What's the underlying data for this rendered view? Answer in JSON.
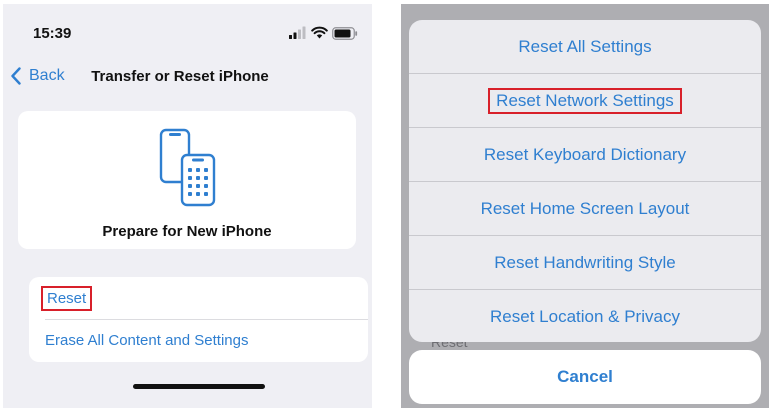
{
  "left_screen": {
    "status_bar": {
      "time": "15:39",
      "icons": [
        "cellular-signal-icon",
        "wifi-icon",
        "battery-icon"
      ]
    },
    "nav": {
      "back_label": "Back",
      "title": "Transfer or Reset iPhone"
    },
    "prepare_card": {
      "icon": "phones-transfer-icon",
      "label": "Prepare for New iPhone"
    },
    "reset_list": {
      "items": [
        {
          "label": "Reset",
          "highlighted": true
        },
        {
          "label": "Erase All Content and Settings",
          "highlighted": false
        }
      ]
    }
  },
  "right_screen": {
    "background_label": "Reset",
    "action_sheet": {
      "items": [
        {
          "label": "Reset All Settings",
          "highlighted": false
        },
        {
          "label": "Reset Network Settings",
          "highlighted": true
        },
        {
          "label": "Reset Keyboard Dictionary",
          "highlighted": false
        },
        {
          "label": "Reset Home Screen Layout",
          "highlighted": false
        },
        {
          "label": "Reset Handwriting Style",
          "highlighted": false
        },
        {
          "label": "Reset Location & Privacy",
          "highlighted": false
        }
      ],
      "cancel_label": "Cancel"
    }
  },
  "colors": {
    "accent_blue": "#2f7fd0",
    "highlight_red": "#d8202a",
    "grouped_background": "#efeff4",
    "dimmed_overlay": "#aeaeb2"
  }
}
